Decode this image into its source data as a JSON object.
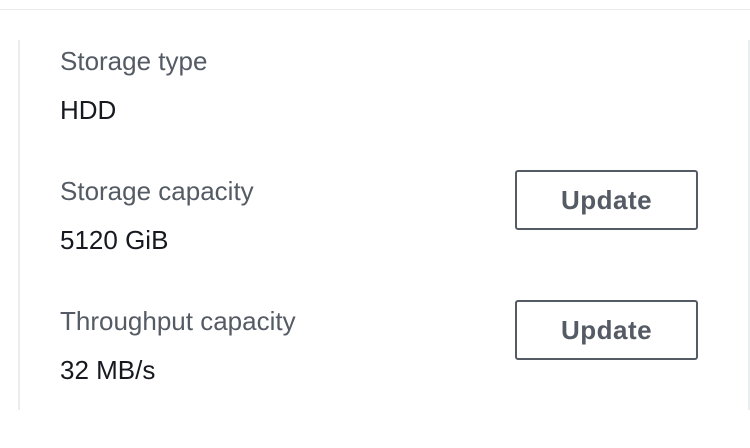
{
  "storage_type": {
    "label": "Storage type",
    "value": "HDD"
  },
  "storage_capacity": {
    "label": "Storage capacity",
    "value": "5120 GiB",
    "button_label": "Update"
  },
  "throughput_capacity": {
    "label": "Throughput capacity",
    "value": "32 MB/s",
    "button_label": "Update"
  }
}
